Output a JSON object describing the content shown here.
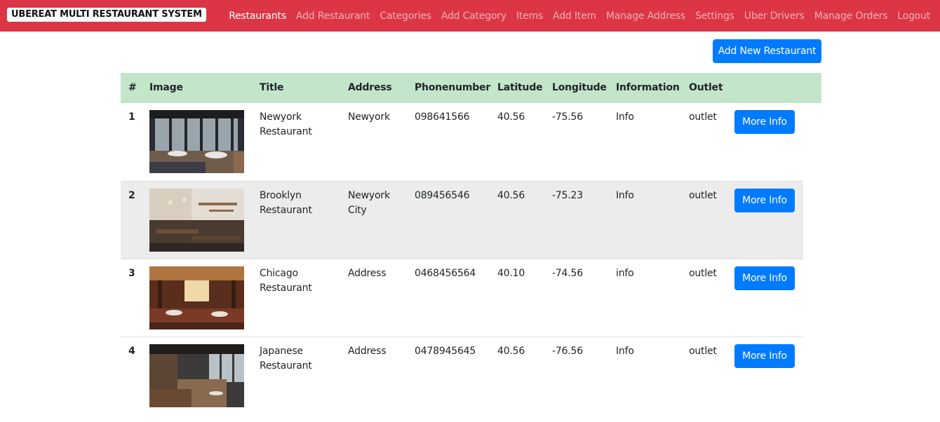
{
  "navbar": {
    "brand": "UBEREAT MULTI RESTAURANT SYSTEM",
    "links": [
      "Restaurants",
      "Add Restaurant",
      "Categories",
      "Add Category",
      "Items",
      "Add Item",
      "Manage Address",
      "Settings",
      "Uber Drivers",
      "Manage Orders",
      "Logout"
    ],
    "active_index": 0,
    "color": "#dc3545"
  },
  "toolbar": {
    "add_label": "Add New Restaurant"
  },
  "table": {
    "header_color": "#c3e6cb",
    "columns": [
      "#",
      "Image",
      "Title",
      "Address",
      "Phonenumber",
      "Latitude",
      "Longitude",
      "Information",
      "Outlet"
    ],
    "rows": [
      {
        "num": "1",
        "title_line1": "Newyork",
        "title_line2": "Restaurant",
        "address_line1": "Newyork",
        "address_line2": "",
        "phone": "098641566",
        "lat": "40.56",
        "lng": "-75.56",
        "info": "Info",
        "outlet": "outlet",
        "action": "More Info"
      },
      {
        "num": "2",
        "title_line1": "Brooklyn",
        "title_line2": "Restaurant",
        "address_line1": "Newyork",
        "address_line2": "City",
        "phone": "089456546",
        "lat": "40.56",
        "lng": "-75.23",
        "info": "Info",
        "outlet": "outlet",
        "action": "More Info"
      },
      {
        "num": "3",
        "title_line1": "Chicago",
        "title_line2": "Restaurant",
        "address_line1": "Address",
        "address_line2": "",
        "phone": "0468456564",
        "lat": "40.10",
        "lng": "-74.56",
        "info": "info",
        "outlet": "outlet",
        "action": "More Info"
      },
      {
        "num": "4",
        "title_line1": "Japanese",
        "title_line2": "Restaurant",
        "address_line1": "Address",
        "address_line2": "",
        "phone": "0478945645",
        "lat": "40.56",
        "lng": "-76.56",
        "info": "Info",
        "outlet": "outlet",
        "action": "More Info"
      }
    ]
  }
}
